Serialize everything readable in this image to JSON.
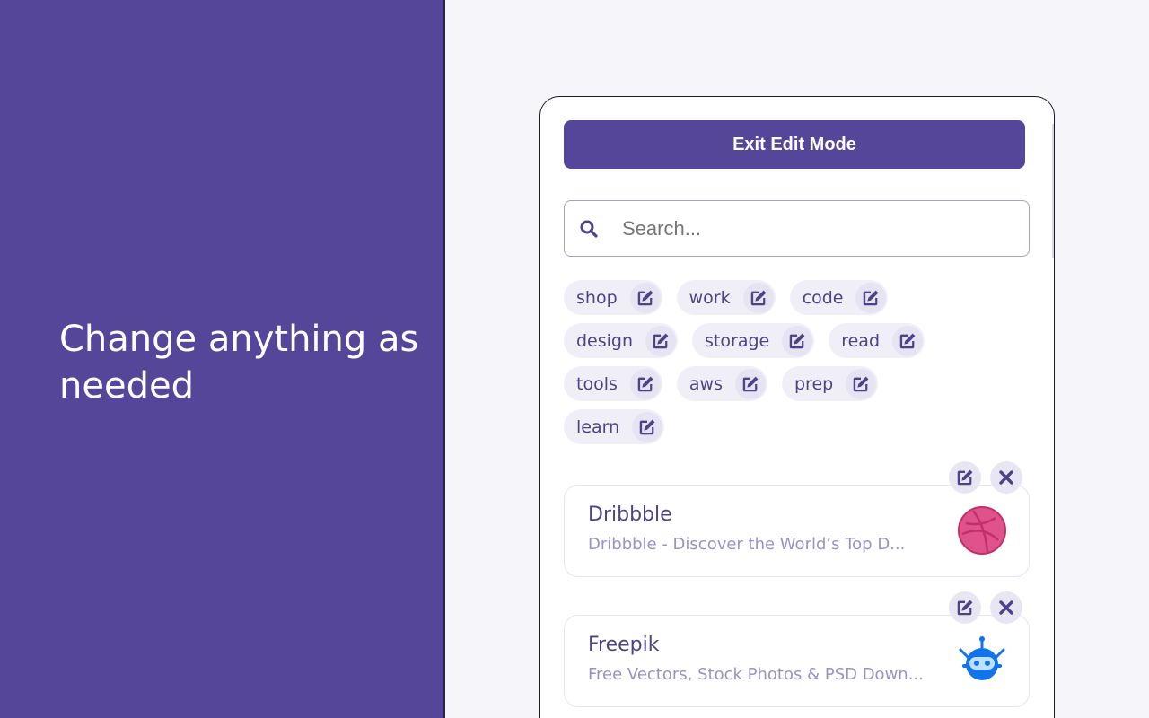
{
  "tagline": "Change anything as needed",
  "colors": {
    "brand": "#55469a",
    "tag_bg": "#f0eff7",
    "accent_text": "#4e4389"
  },
  "exit_button": {
    "label": "Exit Edit Mode"
  },
  "search": {
    "placeholder": "Search...",
    "value": "",
    "icon": "search-icon"
  },
  "tags": [
    [
      "shop",
      "work",
      "code"
    ],
    [
      "design",
      "storage",
      "read"
    ],
    [
      "tools",
      "aws",
      "prep"
    ],
    [
      "learn"
    ]
  ],
  "bookmarks": [
    {
      "title": "Dribbble",
      "description": "Dribbble - Discover the World’s Top D...",
      "logo": "dribbble-logo"
    },
    {
      "title": "Freepik",
      "description": "Free Vectors, Stock Photos & PSD Down...",
      "logo": "freepik-logo"
    }
  ]
}
